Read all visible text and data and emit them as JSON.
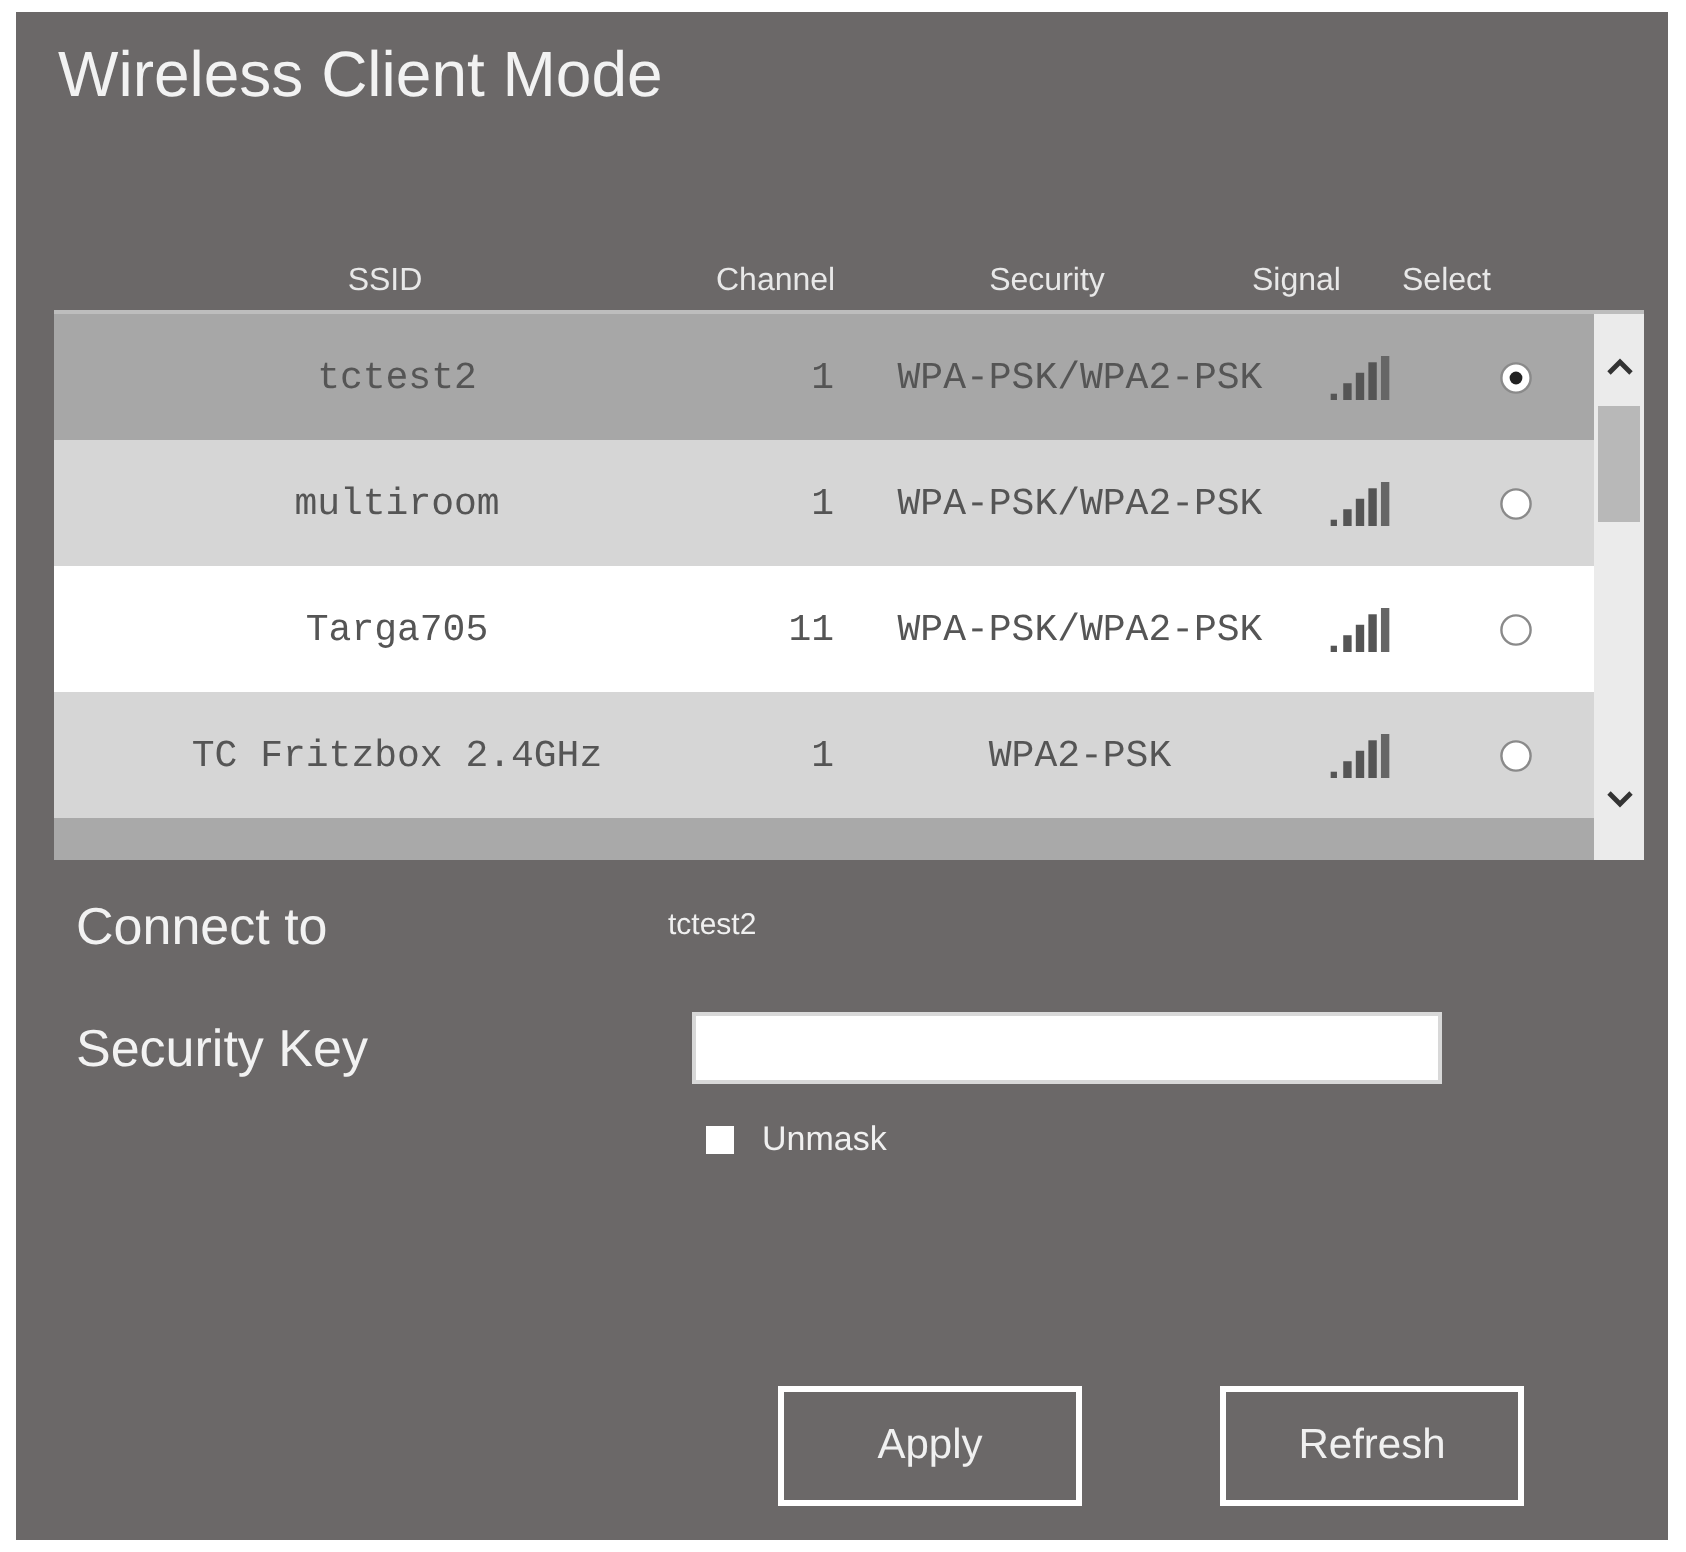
{
  "window": {
    "title": "Wireless Client Mode"
  },
  "table": {
    "columns": [
      "SSID",
      "Channel",
      "Security",
      "Signal",
      "Select"
    ],
    "rows": [
      {
        "ssid": "tctest2",
        "channel": "1",
        "security": "WPA-PSK/WPA2-PSK",
        "selected": true
      },
      {
        "ssid": "multiroom",
        "channel": "1",
        "security": "WPA-PSK/WPA2-PSK",
        "selected": false
      },
      {
        "ssid": "Targa705",
        "channel": "11",
        "security": "WPA-PSK/WPA2-PSK",
        "selected": false
      },
      {
        "ssid": "TC Fritzbox 2.4GHz",
        "channel": "1",
        "security": "WPA2-PSK",
        "selected": false
      }
    ]
  },
  "connect_to": {
    "label": "Connect to",
    "value": "tctest2"
  },
  "security_key": {
    "label": "Security Key"
  },
  "unmask": {
    "label": "Unmask",
    "checked": false
  },
  "buttons": [
    "Apply",
    "Refresh"
  ]
}
